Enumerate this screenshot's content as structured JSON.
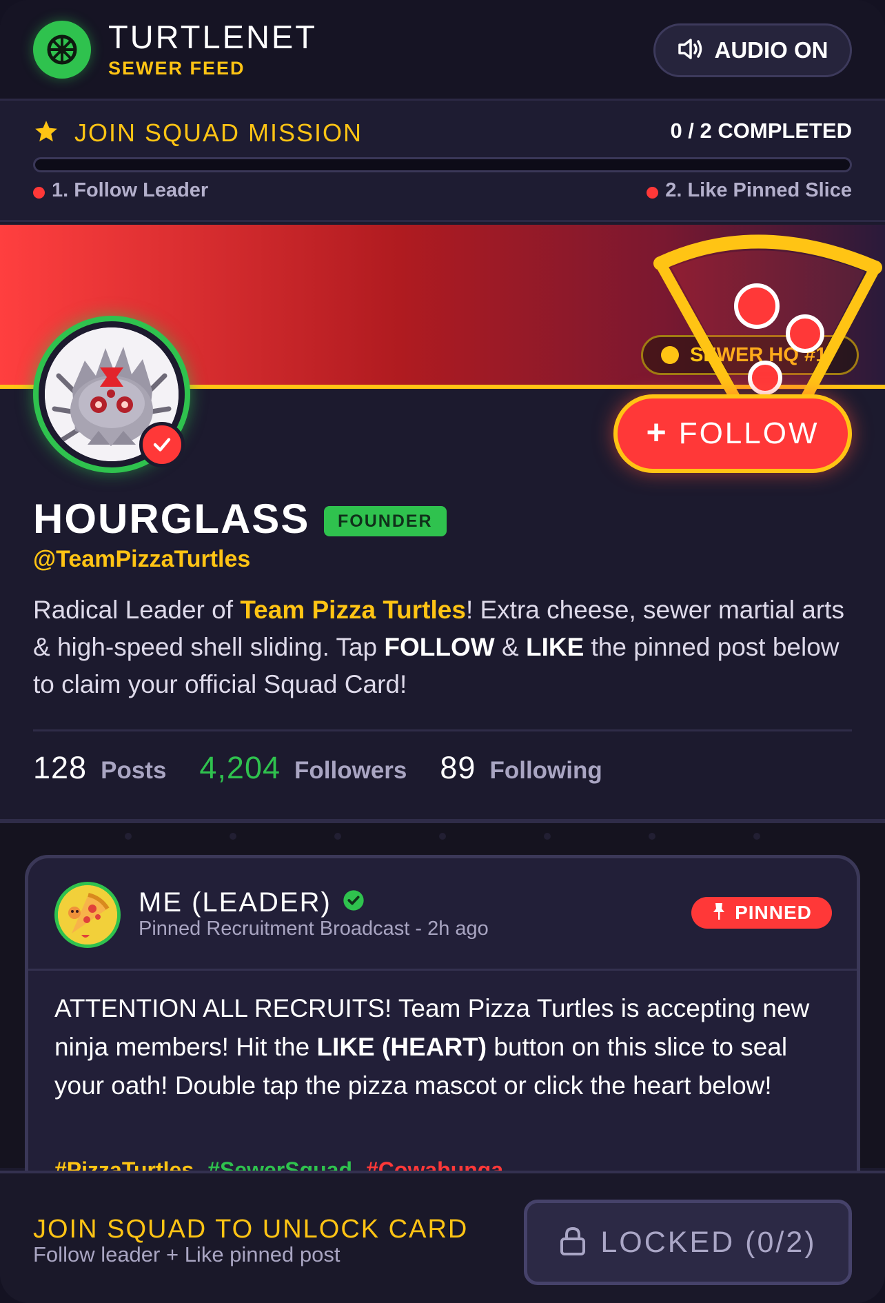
{
  "header": {
    "app_title": "TURTLENET",
    "app_subtitle": "SEWER FEED",
    "logo_icon": "shell-wheel-icon",
    "audio_label": "AUDIO ON",
    "audio_icon": "speaker-icon"
  },
  "mission": {
    "title": "JOIN SQUAD MISSION",
    "count": "0 / 2 COMPLETED",
    "progress_fraction": 0,
    "tasks": [
      {
        "label": "1. Follow Leader",
        "status_color": "#ff3838"
      },
      {
        "label": "2. Like Pinned Slice",
        "status_color": "#ff3838"
      }
    ]
  },
  "banner": {
    "hq_badge": "SEWER HQ #1"
  },
  "profile": {
    "name": "HOURGLASS",
    "role_tag": "FOUNDER",
    "handle": "@TeamPizzaTurtles",
    "bio": {
      "part1": "Radical Leader of ",
      "team": "Team Pizza Turtles",
      "part2": "! Extra cheese, sewer martial arts & high-speed shell sliding. Tap ",
      "follow_word": "FOLLOW",
      "part3": " & ",
      "like_word": "LIKE",
      "part4": " the pinned post below to claim your official Squad Card!"
    },
    "follow_button": "FOLLOW",
    "stats": [
      {
        "value": "128",
        "label": "Posts"
      },
      {
        "value": "4,204",
        "label": "Followers"
      },
      {
        "value": "89",
        "label": "Following"
      }
    ]
  },
  "post": {
    "author": "ME (LEADER)",
    "meta": "Pinned Recruitment Broadcast - 2h ago",
    "pinned_label": "PINNED",
    "body": {
      "part1": "ATTENTION ALL RECRUITS! Team Pizza Turtles is accepting new ninja members! Hit the ",
      "strong": "LIKE (HEART)",
      "part2": " button on this slice to seal your oath! Double tap the pizza mascot or click the heart below!"
    },
    "hashtags": [
      "#PizzaTurtles",
      "#SewerSquad",
      "#Cowabunga"
    ]
  },
  "bottom": {
    "cta_title": "JOIN SQUAD TO UNLOCK CARD",
    "cta_sub": "Follow leader + Like pinned post",
    "locked_label": "LOCKED (0/2)",
    "locked_icon": "lock-icon"
  },
  "colors": {
    "accent_yellow": "#ffc414",
    "accent_green": "#2fc24e",
    "accent_red": "#ff3838",
    "background": "#1c1a2e"
  }
}
